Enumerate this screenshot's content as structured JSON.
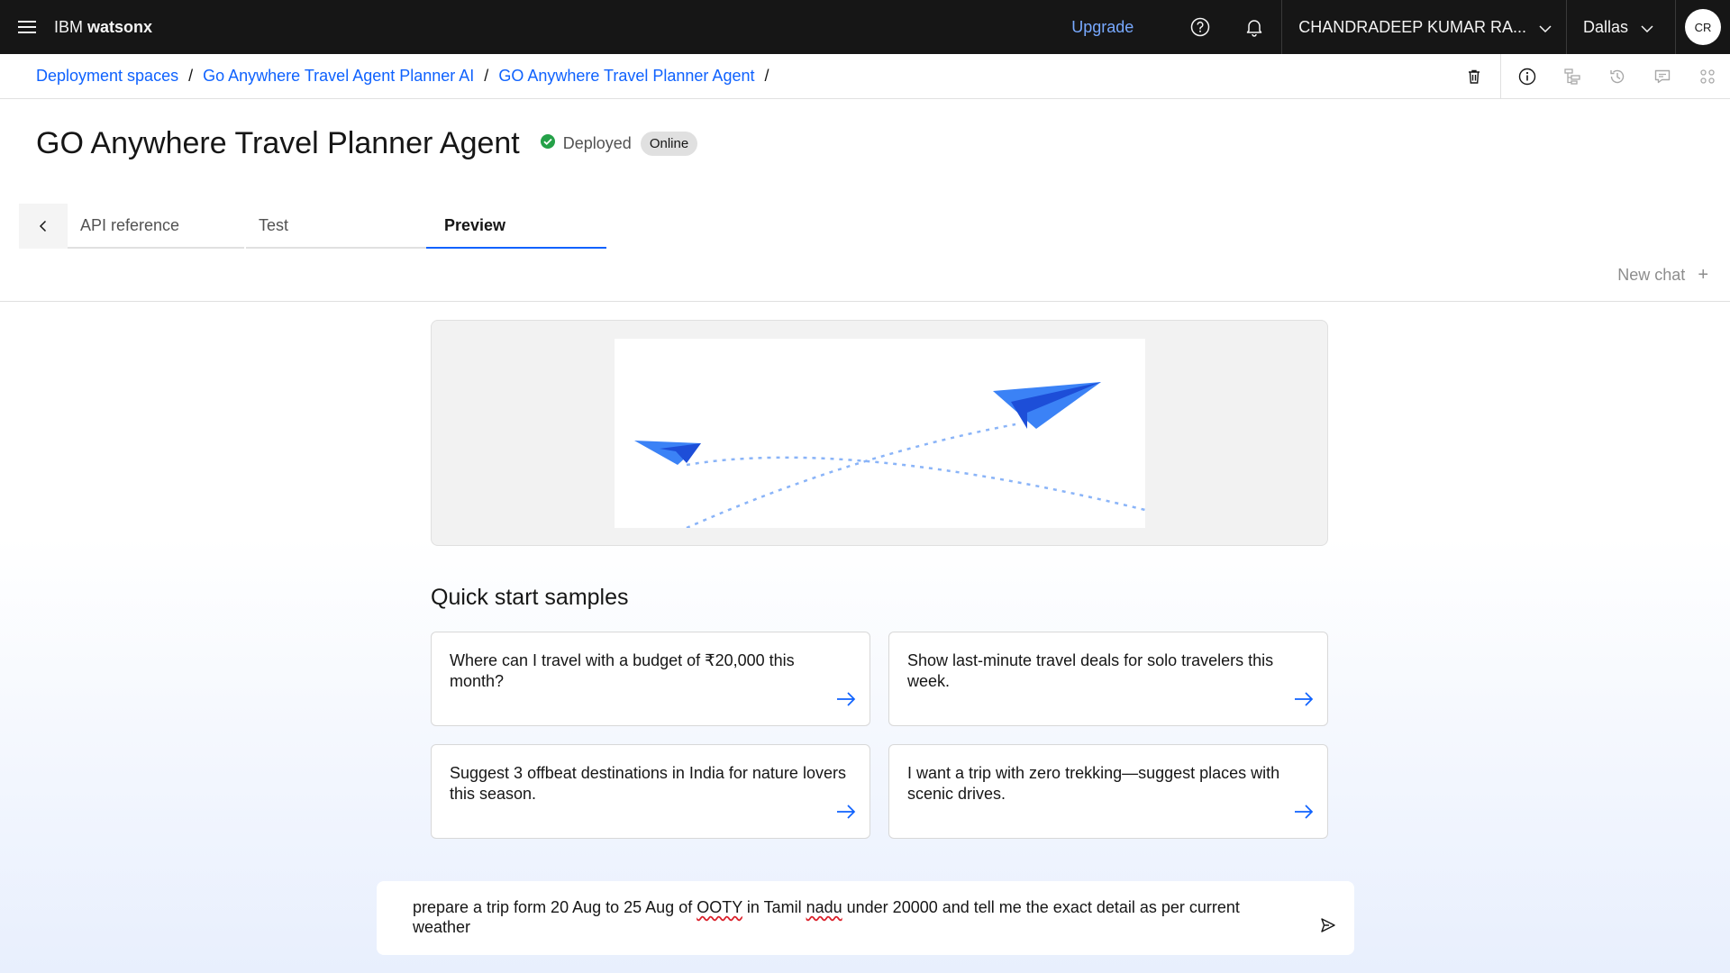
{
  "header": {
    "brand_prefix": "IBM ",
    "brand_name": "watsonx",
    "upgrade_label": "Upgrade",
    "account_name": "CHANDRADEEP KUMAR RA...",
    "region": "Dallas",
    "avatar_initials": "CR",
    "icons": [
      "menu-icon",
      "help-icon",
      "notification-icon",
      "chevron-down-icon"
    ]
  },
  "breadcrumb": {
    "items": [
      "Deployment spaces",
      "Go Anywhere Travel Agent Planner AI",
      "GO Anywhere Travel Planner Agent"
    ],
    "separator": "/",
    "action_icons": [
      "trash-icon",
      "info-icon",
      "tree-view-icon",
      "history-icon",
      "comment-icon",
      "apps-icon"
    ]
  },
  "page": {
    "title": "GO Anywhere Travel Planner Agent",
    "status": "Deployed",
    "status_color": "#24a148",
    "tag": "Online"
  },
  "tabs": {
    "items": [
      "API reference",
      "Test",
      "Preview"
    ],
    "active": "Preview"
  },
  "chat": {
    "new_chat_label": "New chat",
    "new_chat_icon": "+",
    "quick_start_title": "Quick start samples",
    "samples": [
      "Where can I travel with a budget of ₹20,000 this month?",
      "Show last-minute travel deals for solo travelers this week.",
      "Suggest 3 offbeat destinations in India for nature lovers this season.",
      "I want a trip with zero trekking—suggest places with scenic drives."
    ],
    "input": {
      "part1": "prepare a trip form 20 Aug to 25 Aug of ",
      "misspelled1": "OOTY",
      "part2": " in Tamil ",
      "misspelled2": "nadu",
      "part3": " under 20000 and tell me the exact detail as per current weather"
    }
  },
  "colors": {
    "accent": "#0f62fe",
    "topbar": "#161616",
    "upgrade": "#78a9ff",
    "plane": "#3b82f6"
  }
}
